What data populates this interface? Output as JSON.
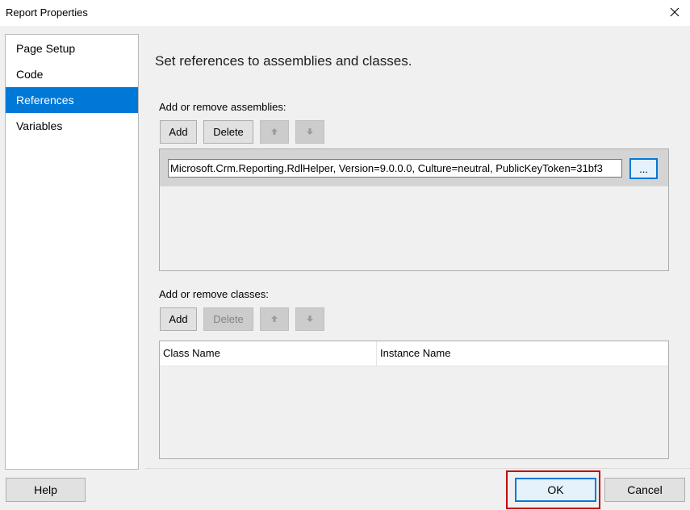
{
  "window": {
    "title": "Report Properties"
  },
  "nav": {
    "items": [
      {
        "label": "Page Setup",
        "selected": false
      },
      {
        "label": "Code",
        "selected": false
      },
      {
        "label": "References",
        "selected": true
      },
      {
        "label": "Variables",
        "selected": false
      }
    ]
  },
  "main": {
    "heading": "Set references to assemblies and classes.",
    "assemblies": {
      "label": "Add or remove assemblies:",
      "add_label": "Add",
      "delete_label": "Delete",
      "items": [
        {
          "value": "Microsoft.Crm.Reporting.RdlHelper, Version=9.0.0.0, Culture=neutral, PublicKeyToken=31bf3",
          "browse_label": "..."
        }
      ]
    },
    "classes": {
      "label": "Add or remove classes:",
      "add_label": "Add",
      "delete_label": "Delete",
      "columns": [
        "Class Name",
        "Instance Name"
      ],
      "rows": []
    }
  },
  "footer": {
    "help_label": "Help",
    "ok_label": "OK",
    "cancel_label": "Cancel"
  },
  "colors": {
    "selection": "#0078d7",
    "highlight": "#c00000",
    "disabled_button": "#cccccc"
  },
  "icons": {
    "close": "close-icon",
    "move_up": "arrow-up-icon",
    "move_down": "arrow-down-icon"
  }
}
